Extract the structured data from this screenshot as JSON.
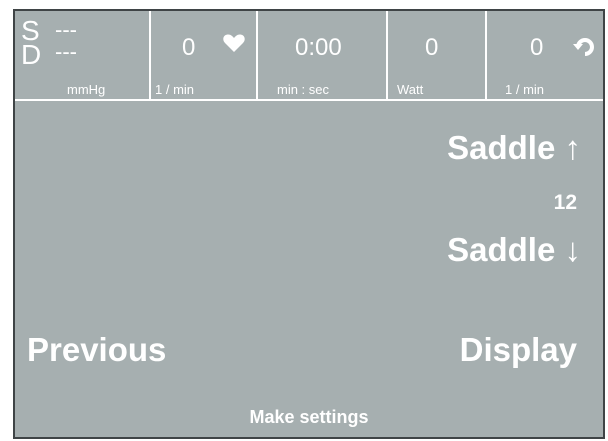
{
  "status_bar": {
    "blood_pressure": {
      "systolic_label": "S",
      "systolic_value": "---",
      "diastolic_label": "D",
      "diastolic_value": "---",
      "unit": "mmHg"
    },
    "heart_rate": {
      "value": "0",
      "unit": "1 / min",
      "icon": "heart-icon"
    },
    "time": {
      "value": "0:00",
      "unit": "min : sec"
    },
    "power": {
      "value": "0",
      "unit": "Watt"
    },
    "cadence": {
      "value": "0",
      "unit": "1 / min",
      "icon": "rotation-icon"
    }
  },
  "main": {
    "saddle_up_label": "Saddle",
    "saddle_up_arrow": "↑",
    "saddle_value": "12",
    "saddle_down_label": "Saddle",
    "saddle_down_arrow": "↓",
    "previous_label": "Previous",
    "display_label": "Display",
    "make_settings_label": "Make settings"
  },
  "colors": {
    "background": "#a6afb0",
    "text": "#ffffff",
    "divider": "#ffffff",
    "frame": "#3f4446"
  }
}
